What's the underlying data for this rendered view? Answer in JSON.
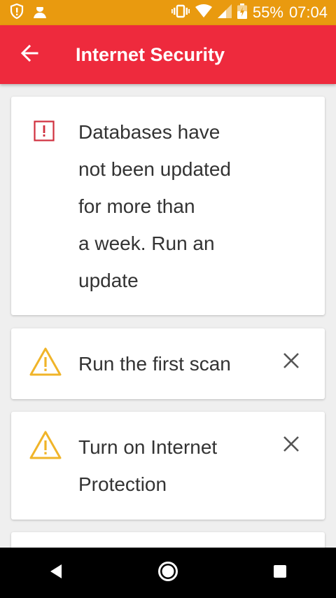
{
  "status_bar": {
    "battery_percent": "55%",
    "time": "07:04",
    "icons": [
      "shield-alert-icon",
      "user-icon",
      "vibrate-icon",
      "wifi-icon",
      "signal-icon",
      "battery-icon"
    ]
  },
  "app_bar": {
    "title": "Internet Security",
    "back_icon": "arrow-back-icon"
  },
  "cards": [
    {
      "icon": "error-square-icon",
      "lines": [
        "Databases have",
        "not been updated",
        "for more than",
        "a week. Run an",
        "update"
      ]
    },
    {
      "icon": "warning-triangle-icon",
      "lines": [
        "Run the first scan"
      ],
      "dismiss_icon": "close-icon"
    },
    {
      "icon": "warning-triangle-icon",
      "lines": [
        "Turn on Internet",
        "Protection"
      ],
      "dismiss_icon": "close-icon"
    }
  ],
  "nav_bar": {
    "icons": [
      "back-triangle-icon",
      "home-circle-icon",
      "recents-square-icon"
    ]
  },
  "colors": {
    "status_bar": "#e99a0f",
    "app_bar": "#ee2a3d",
    "warning": "#f0b429",
    "error": "#d0303e",
    "background": "#efefef"
  }
}
